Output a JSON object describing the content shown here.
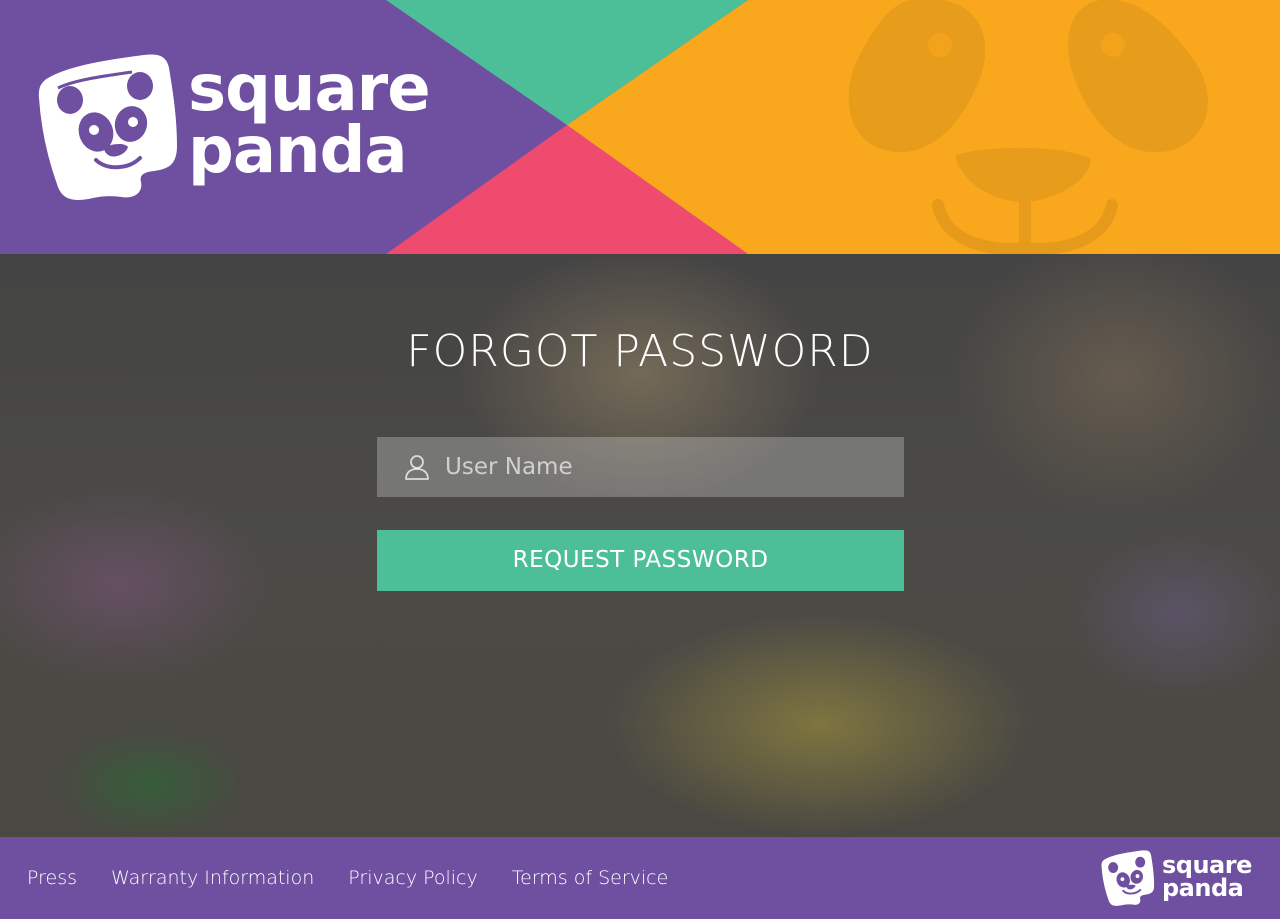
{
  "brand": {
    "logo_line1": "square",
    "logo_line2": "panda",
    "colors": {
      "purple": "#6e4fa0",
      "teal": "#4dbf98",
      "pink": "#ef4b6f",
      "orange": "#f9a81d"
    }
  },
  "form": {
    "title": "FORGOT PASSWORD",
    "username_placeholder": "User Name",
    "username_value": "",
    "username_icon": "user-icon",
    "submit_label": "REQUEST PASSWORD"
  },
  "footer": {
    "links": [
      "Press",
      "Warranty Information",
      "Privacy Policy",
      "Terms of Service"
    ],
    "logo_line1": "square",
    "logo_line2": "panda"
  }
}
